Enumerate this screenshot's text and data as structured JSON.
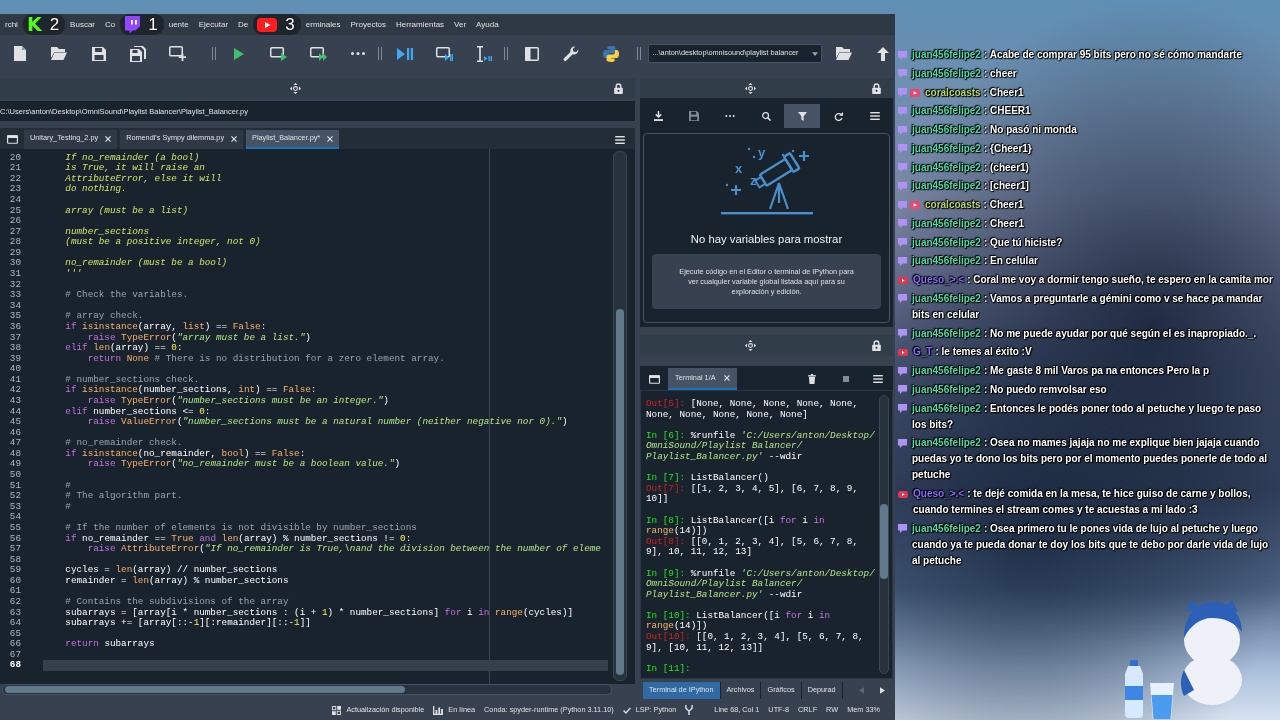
{
  "menu_bar": [
    {
      "kind": "menu",
      "label": "rchi"
    },
    {
      "kind": "kick",
      "logo": "K",
      "count": "2"
    },
    {
      "kind": "menu",
      "label": "Buscar"
    },
    {
      "kind": "menu",
      "label": "Co"
    },
    {
      "kind": "twitch",
      "count": "1"
    },
    {
      "kind": "menu",
      "label": "uente"
    },
    {
      "kind": "menu",
      "label": "Ejecutar"
    },
    {
      "kind": "menu",
      "label": "De"
    },
    {
      "kind": "youtube",
      "count": "3"
    },
    {
      "kind": "menu",
      "label": "erminales"
    },
    {
      "kind": "menu",
      "label": "Proyectos"
    },
    {
      "kind": "menu",
      "label": "Herramientas"
    },
    {
      "kind": "menu",
      "label": "Ver"
    },
    {
      "kind": "menu",
      "label": "Ayuda"
    }
  ],
  "toolbar": {
    "working_directory": "...\\anton\\desktop\\omnisound\\playlist balancer"
  },
  "editor": {
    "file_path": "C:\\Users\\anton\\Desktop\\OmniSound\\Playlist Balancer\\Playlist_Balancer.py",
    "tabs": [
      {
        "label": "Unitary_Testing_2.py",
        "selected": false
      },
      {
        "label": "Romendi's Sympy dilemma.py",
        "selected": false
      },
      {
        "label": "Playlist_Balancer.py*",
        "selected": true
      }
    ],
    "lines": [
      {
        "number": "20",
        "current": false,
        "tokens": [
          {
            "kind": "docstring",
            "text": "    If no_remainder (a bool)"
          }
        ]
      },
      {
        "number": "21",
        "current": false,
        "tokens": [
          {
            "kind": "docstring",
            "text": "    is True, it will raise an"
          }
        ]
      },
      {
        "number": "22",
        "current": false,
        "tokens": [
          {
            "kind": "docstring",
            "text": "    AttributeError, else it will"
          }
        ]
      },
      {
        "number": "23",
        "current": false,
        "tokens": [
          {
            "kind": "docstring",
            "text": "    do nothing."
          }
        ]
      },
      {
        "number": "24",
        "current": false
      },
      {
        "number": "25",
        "current": false,
        "tokens": [
          {
            "kind": "docstring",
            "text": "    array (must be a list)"
          }
        ]
      },
      {
        "number": "26",
        "current": false
      },
      {
        "number": "27",
        "current": false,
        "tokens": [
          {
            "kind": "docstring",
            "text": "    number_sections"
          }
        ]
      },
      {
        "number": "28",
        "current": false,
        "tokens": [
          {
            "kind": "docstring",
            "text": "    (must be a positive integer, not 0)"
          }
        ]
      },
      {
        "number": "29",
        "current": false
      },
      {
        "number": "30",
        "current": false,
        "tokens": [
          {
            "kind": "docstring",
            "text": "    no_remainder (must be a bool)"
          }
        ]
      },
      {
        "number": "31",
        "current": false,
        "tokens": [
          {
            "kind": "docstring",
            "text": "    '''"
          }
        ]
      },
      {
        "number": "32",
        "current": false
      },
      {
        "number": "33",
        "current": false,
        "tokens": [
          {
            "kind": "comment",
            "text": "    # Check the variables."
          }
        ]
      },
      {
        "number": "34",
        "current": false
      },
      {
        "number": "35",
        "current": false,
        "tokens": [
          {
            "kind": "comment",
            "text": "    # array check."
          }
        ]
      },
      {
        "number": "36",
        "current": false,
        "tokens": [
          {
            "kind": "keyword",
            "text": "    if"
          },
          {
            "kind": "builtin",
            "text": " isinstance"
          },
          {
            "kind": "text",
            "text": "(array, "
          },
          {
            "kind": "builtin",
            "text": "list"
          },
          {
            "kind": "text",
            "text": ") == "
          },
          {
            "kind": "builtin",
            "text": "False"
          },
          {
            "kind": "text",
            "text": ":"
          }
        ]
      },
      {
        "number": "37",
        "current": false,
        "tokens": [
          {
            "kind": "keyword",
            "text": "        raise"
          },
          {
            "kind": "builtin",
            "text": " TypeError"
          },
          {
            "kind": "text",
            "text": "("
          },
          {
            "kind": "string",
            "text": "\"array must be a list.\""
          },
          {
            "kind": "text",
            "text": ")"
          }
        ]
      },
      {
        "number": "38",
        "current": false,
        "tokens": [
          {
            "kind": "keyword",
            "text": "    elif"
          },
          {
            "kind": "builtin",
            "text": " len"
          },
          {
            "kind": "text",
            "text": "(array) == "
          },
          {
            "kind": "number",
            "text": "0"
          },
          {
            "kind": "text",
            "text": ":"
          }
        ]
      },
      {
        "number": "39",
        "current": false,
        "tokens": [
          {
            "kind": "keyword",
            "text": "        return"
          },
          {
            "kind": "builtin",
            "text": " None"
          },
          {
            "kind": "comment",
            "text": " # There is no distribution for a zero element array."
          }
        ]
      },
      {
        "number": "40",
        "current": false
      },
      {
        "number": "41",
        "current": false,
        "tokens": [
          {
            "kind": "comment",
            "text": "    # number_sections check."
          }
        ]
      },
      {
        "number": "42",
        "current": false,
        "tokens": [
          {
            "kind": "keyword",
            "text": "    if"
          },
          {
            "kind": "builtin",
            "text": " isinstance"
          },
          {
            "kind": "text",
            "text": "(number_sections, "
          },
          {
            "kind": "builtin",
            "text": "int"
          },
          {
            "kind": "text",
            "text": ") == "
          },
          {
            "kind": "builtin",
            "text": "False"
          },
          {
            "kind": "text",
            "text": ":"
          }
        ]
      },
      {
        "number": "43",
        "current": false,
        "tokens": [
          {
            "kind": "keyword",
            "text": "        raise"
          },
          {
            "kind": "builtin",
            "text": " TypeError"
          },
          {
            "kind": "text",
            "text": "("
          },
          {
            "kind": "string",
            "text": "\"number_sections must be an integer.\""
          },
          {
            "kind": "text",
            "text": ")"
          }
        ]
      },
      {
        "number": "44",
        "current": false,
        "tokens": [
          {
            "kind": "keyword",
            "text": "    elif"
          },
          {
            "kind": "text",
            "text": " number_sections <= "
          },
          {
            "kind": "number",
            "text": "0"
          },
          {
            "kind": "text",
            "text": ":"
          }
        ]
      },
      {
        "number": "45",
        "current": false,
        "tokens": [
          {
            "kind": "keyword",
            "text": "        raise"
          },
          {
            "kind": "builtin",
            "text": " ValueError"
          },
          {
            "kind": "text",
            "text": "("
          },
          {
            "kind": "string",
            "text": "\"number_sections must be a natural number (neither negative nor 0).\""
          },
          {
            "kind": "text",
            "text": ")"
          }
        ]
      },
      {
        "number": "46",
        "current": false
      },
      {
        "number": "47",
        "current": false,
        "tokens": [
          {
            "kind": "comment",
            "text": "    # no_remainder check."
          }
        ]
      },
      {
        "number": "48",
        "current": false,
        "tokens": [
          {
            "kind": "keyword",
            "text": "    if"
          },
          {
            "kind": "builtin",
            "text": " isinstance"
          },
          {
            "kind": "text",
            "text": "(no_remainder, "
          },
          {
            "kind": "builtin",
            "text": "bool"
          },
          {
            "kind": "text",
            "text": ") == "
          },
          {
            "kind": "builtin",
            "text": "False"
          },
          {
            "kind": "text",
            "text": ":"
          }
        ]
      },
      {
        "number": "49",
        "current": false,
        "tokens": [
          {
            "kind": "keyword",
            "text": "        raise"
          },
          {
            "kind": "builtin",
            "text": " TypeError"
          },
          {
            "kind": "text",
            "text": "("
          },
          {
            "kind": "string",
            "text": "\"no_remainder must be a boolean value.\""
          },
          {
            "kind": "text",
            "text": ")"
          }
        ]
      },
      {
        "number": "50",
        "current": false
      },
      {
        "number": "51",
        "current": false,
        "tokens": [
          {
            "kind": "comment",
            "text": "    #"
          }
        ]
      },
      {
        "number": "52",
        "current": false,
        "tokens": [
          {
            "kind": "comment",
            "text": "    # The algorithm part."
          }
        ]
      },
      {
        "number": "53",
        "current": false,
        "tokens": [
          {
            "kind": "comment",
            "text": "    #"
          }
        ]
      },
      {
        "number": "54",
        "current": false
      },
      {
        "number": "55",
        "current": false,
        "tokens": [
          {
            "kind": "comment",
            "text": "    # If the number of elements is not divisible by number_sections"
          }
        ]
      },
      {
        "number": "56",
        "current": false,
        "tokens": [
          {
            "kind": "keyword",
            "text": "    if"
          },
          {
            "kind": "text",
            "text": " no_remainder == "
          },
          {
            "kind": "builtin",
            "text": "True"
          },
          {
            "kind": "keyword",
            "text": " and"
          },
          {
            "kind": "builtin",
            "text": " len"
          },
          {
            "kind": "text",
            "text": "(array) % number_sections != "
          },
          {
            "kind": "number",
            "text": "0"
          },
          {
            "kind": "text",
            "text": ":"
          }
        ]
      },
      {
        "number": "57",
        "current": false,
        "tokens": [
          {
            "kind": "keyword",
            "text": "        raise"
          },
          {
            "kind": "builtin",
            "text": " AttributeError"
          },
          {
            "kind": "text",
            "text": "("
          },
          {
            "kind": "string",
            "text": "\"If no_remainder is True,\\nand the division between the number of eleme"
          }
        ]
      },
      {
        "number": "58",
        "current": false
      },
      {
        "number": "59",
        "current": false,
        "tokens": [
          {
            "kind": "text",
            "text": "    cycles = "
          },
          {
            "kind": "builtin",
            "text": "len"
          },
          {
            "kind": "text",
            "text": "(array) // number_sections"
          }
        ]
      },
      {
        "number": "60",
        "current": false,
        "tokens": [
          {
            "kind": "text",
            "text": "    remainder = "
          },
          {
            "kind": "builtin",
            "text": "len"
          },
          {
            "kind": "text",
            "text": "(array) % number_sections"
          }
        ]
      },
      {
        "number": "61",
        "current": false
      },
      {
        "number": "62",
        "current": false,
        "tokens": [
          {
            "kind": "comment",
            "text": "    # Contains the subdivisions of the array"
          }
        ]
      },
      {
        "number": "63",
        "current": false,
        "tokens": [
          {
            "kind": "text",
            "text": "    subarrays = [array[i * number_sections : (i + "
          },
          {
            "kind": "number",
            "text": "1"
          },
          {
            "kind": "text",
            "text": ") * number_sections] "
          },
          {
            "kind": "keyword",
            "text": "for"
          },
          {
            "kind": "text",
            "text": " i "
          },
          {
            "kind": "keyword",
            "text": "in"
          },
          {
            "kind": "builtin",
            "text": " range"
          },
          {
            "kind": "text",
            "text": "(cycles)]"
          }
        ]
      },
      {
        "number": "64",
        "current": false,
        "tokens": [
          {
            "kind": "text",
            "text": "    subarrays += [array[::-"
          },
          {
            "kind": "number",
            "text": "1"
          },
          {
            "kind": "text",
            "text": "][:remainder][::-"
          },
          {
            "kind": "number",
            "text": "1"
          },
          {
            "kind": "text",
            "text": "]]"
          }
        ]
      },
      {
        "number": "65",
        "current": false
      },
      {
        "number": "66",
        "current": false,
        "tokens": [
          {
            "kind": "keyword",
            "text": "    return"
          },
          {
            "kind": "text",
            "text": " subarrays"
          }
        ]
      },
      {
        "number": "67",
        "current": false
      },
      {
        "number": "68",
        "current": true
      }
    ]
  },
  "variable_explorer": {
    "save_disabled": true,
    "filter_active": true,
    "art_letters": [
      "x",
      "y",
      "z"
    ],
    "empty_title": "No hay variables para mostrar",
    "empty_hint": "Ejecute código en el Editor o terminal de IPython para ver cualquier variable global listada aquí para su exploración y edición."
  },
  "console": {
    "tabs": [
      {
        "label": "Terminal 1/A",
        "selected": true
      }
    ],
    "stop_disabled": true,
    "blocks": [
      {
        "lines": [
          [
            {
              "kind": "out_prompt",
              "text": "Out[5]:"
            },
            {
              "kind": "text",
              "text": " [None, None, None, None, None,"
            }
          ],
          [
            {
              "kind": "text",
              "text": "None, None, None, None, None]"
            }
          ]
        ]
      },
      {
        "lines": [
          [
            {
              "kind": "in_prompt",
              "text": "In [6]:"
            },
            {
              "kind": "text",
              "text": " %runfile "
            },
            {
              "kind": "string",
              "text": "'C:/Users/anton/Desktop/"
            }
          ],
          [
            {
              "kind": "string",
              "text": "OmniSound/Playlist Balancer/"
            }
          ],
          [
            {
              "kind": "string",
              "text": "Playlist_Balancer.py'"
            },
            {
              "kind": "text",
              "text": " --wdir"
            }
          ]
        ]
      },
      {
        "lines": [
          [
            {
              "kind": "in_prompt",
              "text": "In [7]:"
            },
            {
              "kind": "text",
              "text": " ListBalancer()"
            }
          ],
          [
            {
              "kind": "out_prompt",
              "text": "Out[7]:"
            },
            {
              "kind": "text",
              "text": " [[1, 2, 3, 4, 5], [6, 7, 8, 9,"
            }
          ],
          [
            {
              "kind": "text",
              "text": "10]]"
            }
          ]
        ]
      },
      {
        "lines": [
          [
            {
              "kind": "in_prompt",
              "text": "In [8]:"
            },
            {
              "kind": "text",
              "text": " ListBalancer([i "
            },
            {
              "kind": "keyword",
              "text": "for"
            },
            {
              "kind": "text",
              "text": " i "
            },
            {
              "kind": "keyword",
              "text": "in"
            }
          ],
          [
            {
              "kind": "builtin",
              "text": "range"
            },
            {
              "kind": "text",
              "text": "(14)])"
            }
          ],
          [
            {
              "kind": "out_prompt",
              "text": "Out[8]:"
            },
            {
              "kind": "text",
              "text": " [[0, 1, 2, 3, 4], [5, 6, 7, 8,"
            }
          ],
          [
            {
              "kind": "text",
              "text": "9], 10, 11, 12, 13]"
            }
          ]
        ]
      },
      {
        "lines": [
          [
            {
              "kind": "in_prompt",
              "text": "In [9]:"
            },
            {
              "kind": "text",
              "text": " %runfile "
            },
            {
              "kind": "string",
              "text": "'C:/Users/anton/Desktop/"
            }
          ],
          [
            {
              "kind": "string",
              "text": "OmniSound/Playlist Balancer/"
            }
          ],
          [
            {
              "kind": "string",
              "text": "Playlist_Balancer.py'"
            },
            {
              "kind": "text",
              "text": " --wdir"
            }
          ]
        ]
      },
      {
        "lines": [
          [
            {
              "kind": "in_prompt",
              "text": "In [10]:"
            },
            {
              "kind": "text",
              "text": " ListBalancer([i "
            },
            {
              "kind": "keyword",
              "text": "for"
            },
            {
              "kind": "text",
              "text": " i "
            },
            {
              "kind": "keyword",
              "text": "in"
            }
          ],
          [
            {
              "kind": "builtin",
              "text": "range"
            },
            {
              "kind": "text",
              "text": "(14)])"
            }
          ],
          [
            {
              "kind": "out_prompt",
              "text": "Out[10]:"
            },
            {
              "kind": "text",
              "text": " [[0, 1, 2, 3, 4], [5, 6, 7, 8,"
            }
          ],
          [
            {
              "kind": "text",
              "text": "9], [10, 11, 12, 13]]"
            }
          ]
        ]
      },
      {
        "lines": [
          [
            {
              "kind": "in_prompt",
              "text": "In [11]:"
            }
          ]
        ]
      }
    ]
  },
  "pane_tabs": {
    "scroll_left_disabled": true,
    "tabs": [
      {
        "label": "Terminal de IPython",
        "selected": true
      },
      {
        "label": "Archivos",
        "selected": false
      },
      {
        "label": "Gráficos",
        "selected": false
      },
      {
        "label": "Depurad",
        "selected": false
      }
    ]
  },
  "status_bar": [
    {
      "kind": "update",
      "text": "Actualización disponible"
    },
    {
      "kind": "online",
      "text": "En línea"
    },
    {
      "kind": "plain",
      "text": "Conda: spyder-runtime (Python 3.11.10)"
    },
    {
      "kind": "lsp",
      "text": "LSP: Python"
    },
    {
      "kind": "git"
    },
    {
      "kind": "plain",
      "text": "Line 68, Col 1"
    },
    {
      "kind": "plain",
      "text": "UTF-8"
    },
    {
      "kind": "plain",
      "text": "CRLF"
    },
    {
      "kind": "plain",
      "text": "RW"
    },
    {
      "kind": "plain",
      "text": "Mem 33%"
    }
  ],
  "chat": [
    {
      "kind": "twitch",
      "broadcaster": false,
      "user": "juan456felipe2",
      "color": "#4fdba6",
      "text": ": Acabe de comprar 95 bits pero no sé cómo mandarte"
    },
    {
      "kind": "twitch",
      "broadcaster": false,
      "user": "juan456felipe2",
      "color": "#4fdba6",
      "text": ": cheer"
    },
    {
      "kind": "twitch",
      "broadcaster": true,
      "user": "coralcoasts",
      "color": "#b9d56b",
      "text": ": Cheer1"
    },
    {
      "kind": "twitch",
      "broadcaster": false,
      "user": "juan456felipe2",
      "color": "#4fdba6",
      "text": ": CHEER1"
    },
    {
      "kind": "twitch",
      "broadcaster": false,
      "user": "juan456felipe2",
      "color": "#4fdba6",
      "text": ": No pasó ni monda"
    },
    {
      "kind": "twitch",
      "broadcaster": false,
      "user": "juan456felipe2",
      "color": "#4fdba6",
      "text": ": {Cheer1}"
    },
    {
      "kind": "twitch",
      "broadcaster": false,
      "user": "juan456felipe2",
      "color": "#4fdba6",
      "text": ": (cheer1)"
    },
    {
      "kind": "twitch",
      "broadcaster": false,
      "user": "juan456felipe2",
      "color": "#4fdba6",
      "text": ": [cheer1]"
    },
    {
      "kind": "twitch",
      "broadcaster": true,
      "user": "coralcoasts",
      "color": "#b9d56b",
      "text": ": Cheer1"
    },
    {
      "kind": "twitch",
      "broadcaster": false,
      "user": "juan456felipe2",
      "color": "#4fdba6",
      "text": ": Cheer1"
    },
    {
      "kind": "twitch",
      "broadcaster": false,
      "user": "juan456felipe2",
      "color": "#4fdba6",
      "text": ": Que tú hiciste?"
    },
    {
      "kind": "twitch",
      "broadcaster": false,
      "user": "juan456felipe2",
      "color": "#4fdba6",
      "text": ": En celular"
    },
    {
      "kind": "youtube",
      "broadcaster": false,
      "user": "Queso_>.<",
      "color": "#8a6cff",
      "text": ": Coral me voy a dormir tengo sueño, te espero en la camita mor"
    },
    {
      "kind": "twitch",
      "broadcaster": false,
      "user": "juan456felipe2",
      "color": "#4fdba6",
      "text": ": Vamos a preguntarle a gémini como v se hace pa mandar bits en celular"
    },
    {
      "kind": "twitch",
      "broadcaster": false,
      "user": "juan456felipe2",
      "color": "#4fdba6",
      "text": ": No me puede ayudar por qué según el es inapropiado._."
    },
    {
      "kind": "youtube",
      "broadcaster": false,
      "user": "G_T",
      "color": "#8a6cff",
      "text": ": le temes al éxito :V"
    },
    {
      "kind": "twitch",
      "broadcaster": false,
      "user": "juan456felipe2",
      "color": "#4fdba6",
      "text": ": Me gaste 8 mil Varos pa na entonces Pero la p"
    },
    {
      "kind": "twitch",
      "broadcaster": false,
      "user": "juan456felipe2",
      "color": "#4fdba6",
      "text": ": No puedo remvolsar eso"
    },
    {
      "kind": "twitch",
      "broadcaster": false,
      "user": "juan456felipe2",
      "color": "#4fdba6",
      "text": ": Entonces le podés poner todo al petuche y luego te paso los bits?"
    },
    {
      "kind": "twitch",
      "broadcaster": false,
      "user": "juan456felipe2",
      "color": "#4fdba6",
      "text": ": Osea no mames jajaja no me explique bien jajaja cuando puedas yo te dono los bits pero por el momento puedes ponerle de todo al petuche"
    },
    {
      "kind": "youtube",
      "broadcaster": false,
      "user": "Queso_>.<",
      "color": "#8a6cff",
      "text": ": te dejé comida en la mesa, te hice guiso de carne y bollos, cuando termines el stream comes y te acuestas a mi lado :3"
    },
    {
      "kind": "twitch",
      "broadcaster": false,
      "user": "juan456felipe2",
      "color": "#4fdba6",
      "text": ": Osea primero tu le pones vida de lujo al petuche y luego cuando ya te pueda donar te doy los bits que te debo por darle vida de lujo al petuche"
    }
  ]
}
